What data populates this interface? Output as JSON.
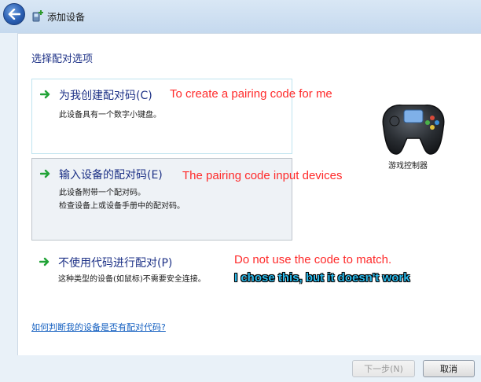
{
  "window": {
    "title": "添加设备"
  },
  "heading": "选择配对选项",
  "options": [
    {
      "title": "为我创建配对码(C)",
      "desc": [
        "此设备具有一个数字小键盘。"
      ],
      "annotation": "To create a pairing code for me"
    },
    {
      "title": "输入设备的配对码(E)",
      "desc": [
        "此设备附带一个配对码。",
        "检查设备上或设备手册中的配对码。"
      ],
      "annotation": "The pairing code input devices"
    },
    {
      "title": "不使用代码进行配对(P)",
      "desc": [
        "这种类型的设备(如鼠标)不需要安全连接。"
      ],
      "annotation": "Do not use the code to match."
    }
  ],
  "user_note": "I chose this, but it doesn't work",
  "device": {
    "label": "游戏控制器",
    "icon": "gamepad-icon"
  },
  "help_link": "如何判断我的设备是否有配对代码?",
  "buttons": {
    "next": "下一步(N)",
    "cancel": "取消"
  },
  "colors": {
    "heading": "#1e3287",
    "annotation_red": "#ff2a2a",
    "note_blue": "#2bb9ea",
    "link": "#1560c0"
  }
}
